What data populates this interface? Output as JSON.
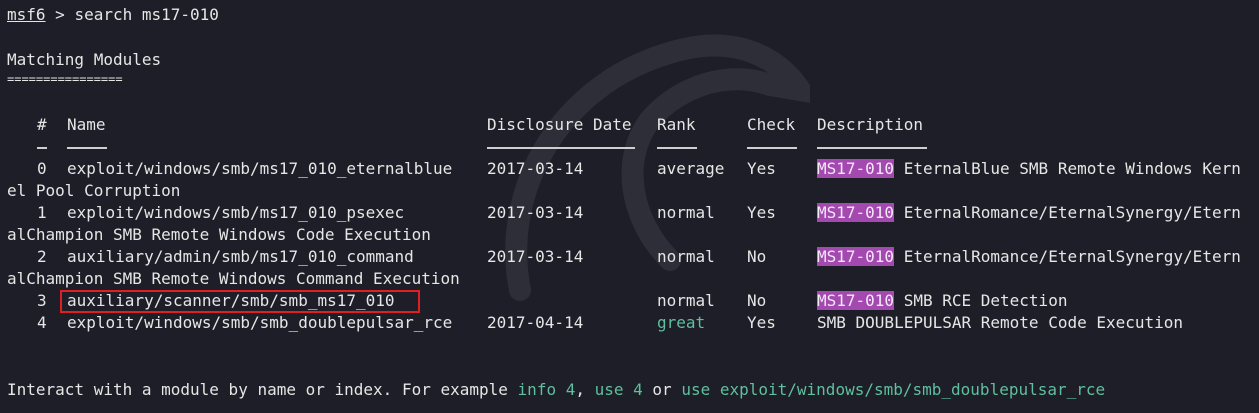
{
  "prompt": {
    "name": "msf6",
    "symbol": " > ",
    "command": "search ms17-010"
  },
  "section_title": "Matching Modules",
  "section_underline": "================",
  "headers": {
    "num": "#",
    "name": "Name",
    "date": "Disclosure Date",
    "rank": "Rank",
    "check": "Check",
    "desc": "Description"
  },
  "rows": [
    {
      "num": "0",
      "name": "exploit/windows/smb/ms17_010_eternalblue",
      "date": "2017-03-14",
      "rank": "average",
      "check": "Yes",
      "tag": "MS17-010",
      "desc": " EternalBlue SMB Remote Windows Kern",
      "wrap": "el Pool Corruption"
    },
    {
      "num": "1",
      "name": "exploit/windows/smb/ms17_010_psexec",
      "date": "2017-03-14",
      "rank": "normal",
      "check": "Yes",
      "tag": "MS17-010",
      "desc": " EternalRomance/EternalSynergy/Etern",
      "wrap": "alChampion SMB Remote Windows Code Execution"
    },
    {
      "num": "2",
      "name": "auxiliary/admin/smb/ms17_010_command",
      "date": "2017-03-14",
      "rank": "normal",
      "check": "No",
      "tag": "MS17-010",
      "desc": " EternalRomance/EternalSynergy/Etern",
      "wrap": "alChampion SMB Remote Windows Command Execution"
    },
    {
      "num": "3",
      "name": "auxiliary/scanner/smb/smb_ms17_010",
      "date": "",
      "rank": "normal",
      "check": "No",
      "tag": "MS17-010",
      "desc": " SMB RCE Detection",
      "wrap": ""
    },
    {
      "num": "4",
      "name": "exploit/windows/smb/smb_doublepulsar_rce",
      "date": "2017-04-14",
      "rank": "great",
      "check": "Yes",
      "tag": "",
      "desc": "SMB DOUBLEPULSAR Remote Code Execution",
      "wrap": ""
    }
  ],
  "footer": {
    "p1": "Interact with a module by name or index. For example ",
    "g1": "info 4",
    "p2": ", ",
    "g2": "use 4",
    "p3": " or ",
    "g3": "use exploit/windows/smb/smb_doublepulsar_rce"
  },
  "colors": {
    "background": "#1d1e27",
    "highlight": "#a349b0",
    "green": "#5fbfa0",
    "redbox": "#e02020"
  }
}
